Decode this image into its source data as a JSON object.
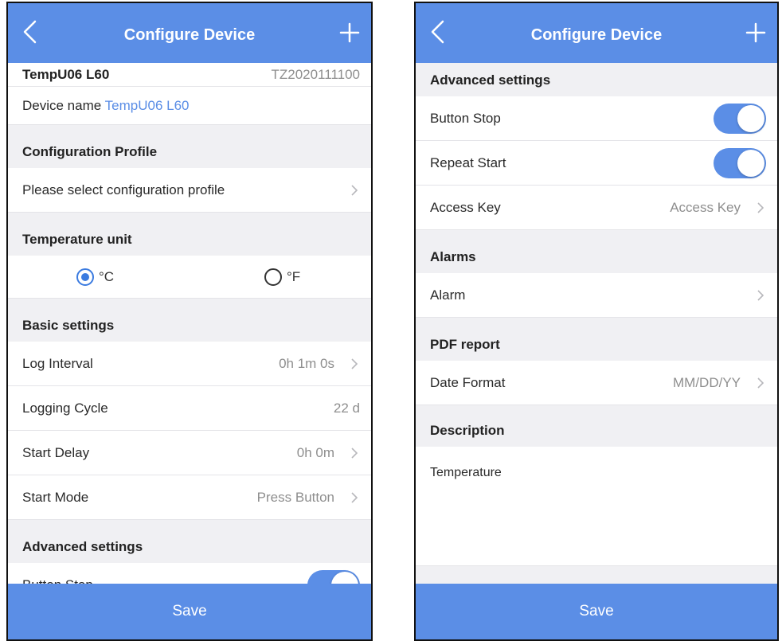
{
  "left": {
    "nav": {
      "title": "Configure Device"
    },
    "device": {
      "model": "TempU06 L60",
      "serial": "TZ2020111100",
      "name_label": "Device name",
      "name_value": "TempU06 L60"
    },
    "config_profile": {
      "header": "Configuration Profile",
      "select_label": "Please select configuration profile"
    },
    "temp_unit": {
      "header": "Temperature unit",
      "celsius": "°C",
      "fahrenheit": "°F",
      "selected": "°C"
    },
    "basic": {
      "header": "Basic settings",
      "log_interval": {
        "label": "Log Interval",
        "value": "0h 1m 0s"
      },
      "logging_cycle": {
        "label": "Logging Cycle",
        "value": "22 d"
      },
      "start_delay": {
        "label": "Start Delay",
        "value": "0h 0m"
      },
      "start_mode": {
        "label": "Start Mode",
        "value": "Press Button"
      }
    },
    "advanced": {
      "header": "Advanced settings",
      "button_stop": {
        "label": "Button Stop",
        "on": true
      }
    },
    "save_label": "Save"
  },
  "right": {
    "nav": {
      "title": "Configure Device"
    },
    "advanced": {
      "header": "Advanced settings",
      "button_stop": {
        "label": "Button Stop",
        "on": true
      },
      "repeat_start": {
        "label": "Repeat Start",
        "on": true
      },
      "access_key": {
        "label": "Access Key",
        "value": "Access Key"
      }
    },
    "alarms": {
      "header": "Alarms",
      "alarm_label": "Alarm"
    },
    "pdf": {
      "header": "PDF report",
      "date_format": {
        "label": "Date Format",
        "value": "MM/DD/YY"
      }
    },
    "description": {
      "header": "Description",
      "text": "Temperature"
    },
    "save_label": "Save"
  },
  "colors": {
    "accent": "#5b8ee6",
    "link": "#5b8ee6",
    "radio": "#3b7be0",
    "background": "#f0f0f3"
  }
}
